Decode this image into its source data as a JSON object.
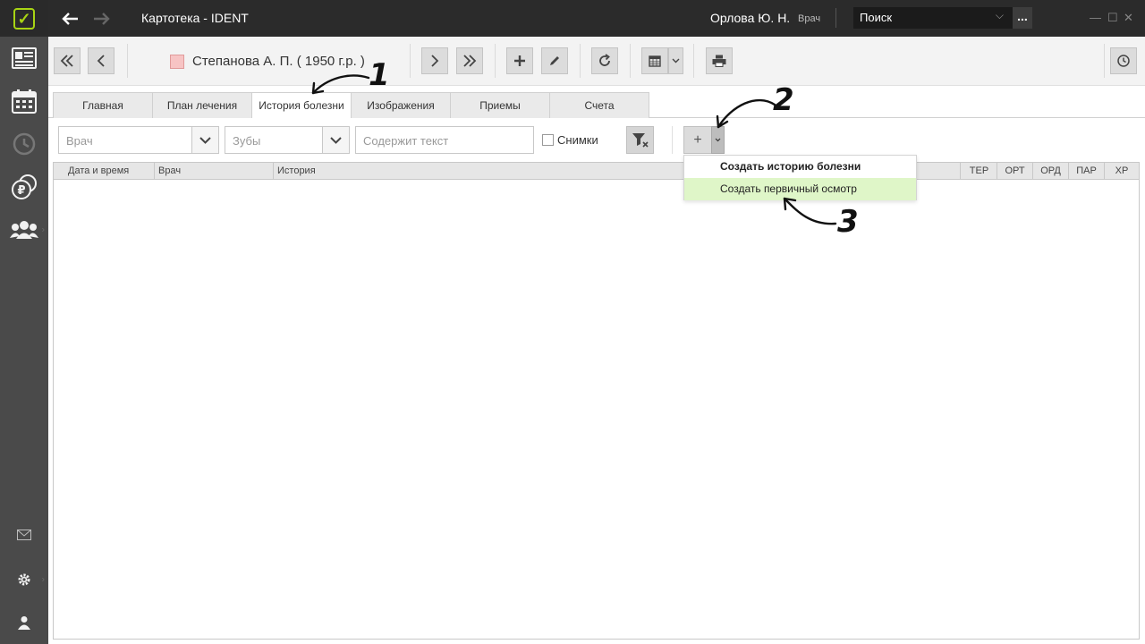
{
  "window": {
    "title": "Картотека - IDENT",
    "user": "Орлова Ю. Н.",
    "role": "Врач",
    "search_placeholder": "Поиск",
    "more_label": "...",
    "minimize": "—",
    "maximize": "☐",
    "close": "✕"
  },
  "sidebar": {
    "logo": "✓",
    "items": [
      {
        "icon": "patient-card-icon"
      },
      {
        "icon": "calendar-icon"
      },
      {
        "icon": "history-icon"
      },
      {
        "icon": "finance-icon"
      },
      {
        "icon": "people-icon"
      },
      {
        "icon": "mail-icon"
      },
      {
        "icon": "gear-icon"
      },
      {
        "icon": "user-icon"
      }
    ]
  },
  "patient": {
    "name": "Степанова А. П. ( 1950 г.р. )",
    "color": "#f7c4c4"
  },
  "tabs": [
    {
      "label": "Главная"
    },
    {
      "label": "План лечения"
    },
    {
      "label": "История болезни",
      "active": true
    },
    {
      "label": "Изображения"
    },
    {
      "label": "Приемы"
    },
    {
      "label": "Счета"
    }
  ],
  "filters": {
    "doctor_placeholder": "Врач",
    "teeth_placeholder": "Зубы",
    "text_placeholder": "Содержит текст",
    "images_label": "Снимки",
    "add_label": "+"
  },
  "table": {
    "columns": [
      "Дата и время",
      "Врач",
      "История",
      "ТЕР",
      "ОРТ",
      "ОРД",
      "ПАР",
      "ХР"
    ]
  },
  "menu": {
    "items": [
      {
        "label": "Создать историю болезни",
        "bold": true
      },
      {
        "label": "Создать первичный осмотр",
        "highlighted": true
      }
    ]
  },
  "annotations": [
    "1",
    "2",
    "3"
  ]
}
